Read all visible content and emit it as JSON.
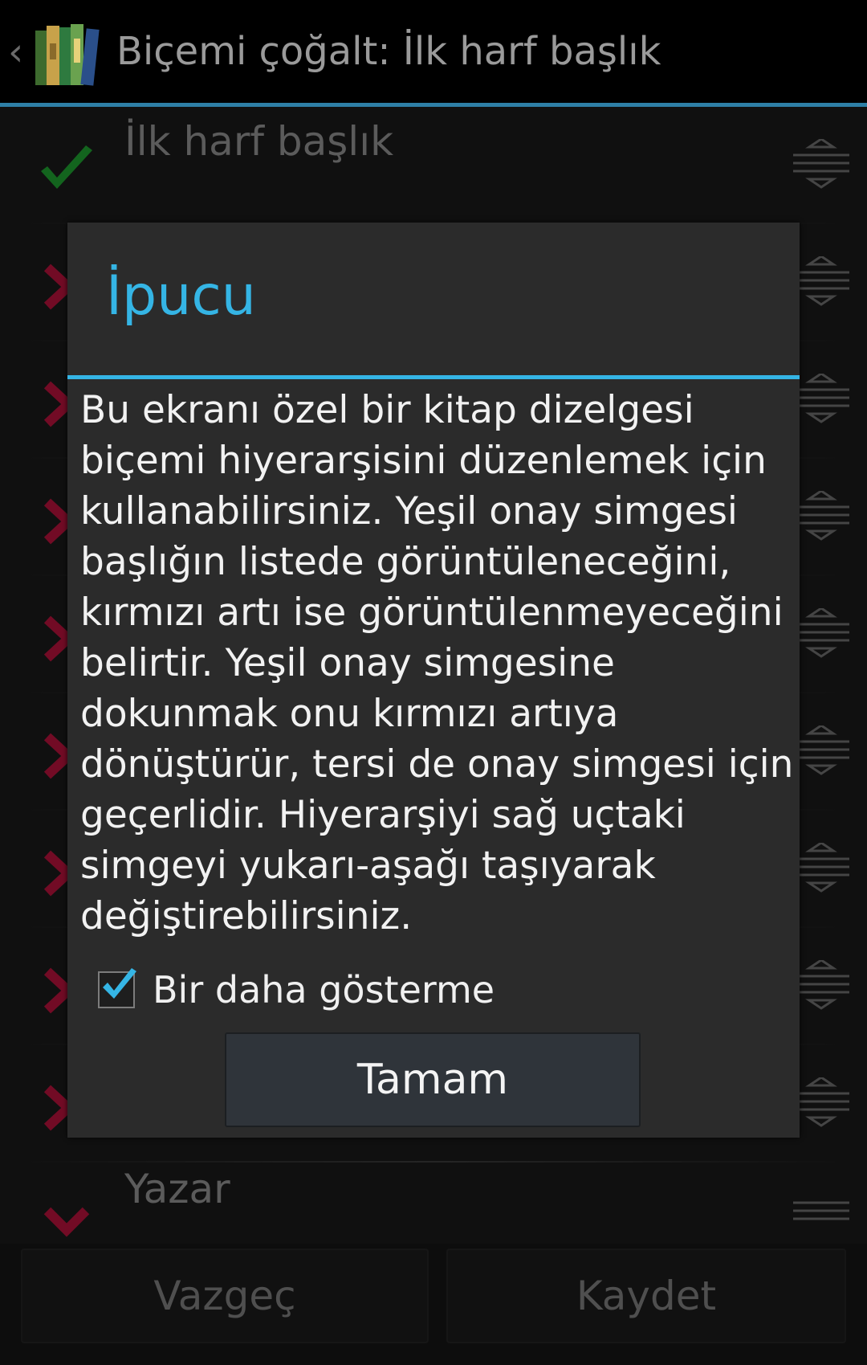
{
  "action_bar": {
    "title": "Biçemi çoğalt: İlk harf başlık",
    "back_icon": "chevron-left-icon",
    "app_icon": "books-app-icon"
  },
  "list": {
    "rows": [
      {
        "label": "İlk harf başlık",
        "status": "visible-check",
        "handle": "drag-handle-icon"
      },
      {
        "label": "",
        "status": "hidden-cross",
        "handle": "drag-handle-icon"
      },
      {
        "label": "",
        "status": "hidden-cross",
        "handle": "drag-handle-icon"
      },
      {
        "label": "",
        "status": "hidden-cross",
        "handle": "drag-handle-icon"
      },
      {
        "label": "",
        "status": "hidden-cross",
        "handle": "drag-handle-icon"
      },
      {
        "label": "",
        "status": "hidden-cross",
        "handle": "drag-handle-icon"
      },
      {
        "label": "",
        "status": "hidden-cross",
        "handle": "drag-handle-icon"
      },
      {
        "label": "",
        "status": "hidden-cross",
        "handle": "drag-handle-icon"
      },
      {
        "label": "",
        "status": "hidden-cross",
        "handle": "drag-handle-icon"
      },
      {
        "label": "Yazar",
        "status": "hidden-cross",
        "handle": "drag-handle-icon"
      }
    ]
  },
  "bottom_bar": {
    "cancel_label": "Vazgeç",
    "save_label": "Kaydet"
  },
  "dialog": {
    "title": "İpucu",
    "message": "Bu ekranı özel bir kitap dizelgesi biçemi hiyerarşisini düzenlemek için kullanabilirsiniz. Yeşil onay simgesi başlığın listede görüntüleneceğini, kırmızı artı ise görüntülenmeyeceğini belirtir. Yeşil onay simgesine dokunmak onu kırmızı artıya dönüştürür, tersi de onay simgesi için geçerlidir. Hiyerarşiyi sağ uçtaki simgeyi yukarı-aşağı taşıyarak değiştirebilirsiniz.",
    "checkbox_label": "Bir daha gösterme",
    "checkbox_checked": true,
    "ok_label": "Tamam"
  },
  "colors": {
    "accent": "#35b5e5",
    "check_green": "#1e9a2e",
    "cross_red": "#b0123a"
  }
}
